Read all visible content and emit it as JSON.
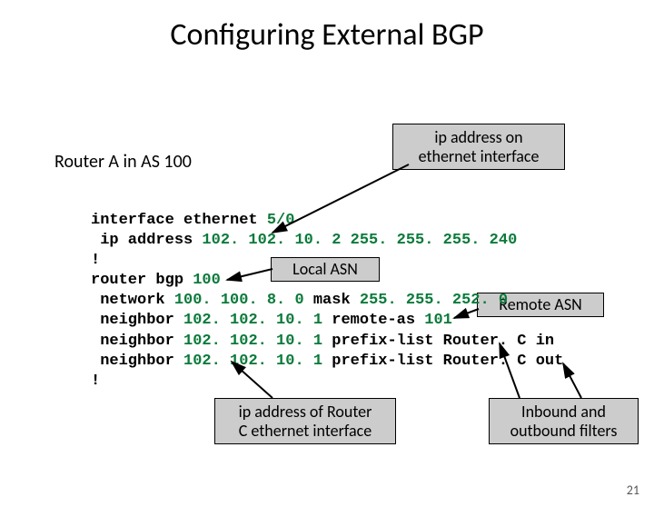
{
  "title": "Configuring External BGP",
  "subtitle": "Router A in AS 100",
  "callouts": {
    "ip_eth": "ip address on\nethernet interface",
    "local_asn": "Local ASN",
    "remote_asn": "Remote ASN",
    "ip_routerc": "ip address of Router\nC ethernet interface",
    "filters": "Inbound and\noutbound filters"
  },
  "code": {
    "l1": "interface ethernet ",
    "l1n": "5/0",
    "l2": " ip address ",
    "l2a": "102. 102. 10. 2 255. 255. 255. 240",
    "l3": "!",
    "l4": "router bgp ",
    "l4n": "100",
    "l5": " network ",
    "l5a": "100. 100. 8. 0",
    "l5b": " mask ",
    "l5c": "255. 255. 252. 0",
    "l6": " neighbor ",
    "l6a": "102. 102. 10. 1",
    "l6b": " remote-as ",
    "l6c": "101",
    "l7": " neighbor ",
    "l7a": "102. 102. 10. 1",
    "l7b": " prefix-list Router. C in",
    "l8": " neighbor ",
    "l8a": "102. 102. 10. 1",
    "l8b": " prefix-list Router. C out",
    "l9": "!"
  },
  "slidenum": "21"
}
